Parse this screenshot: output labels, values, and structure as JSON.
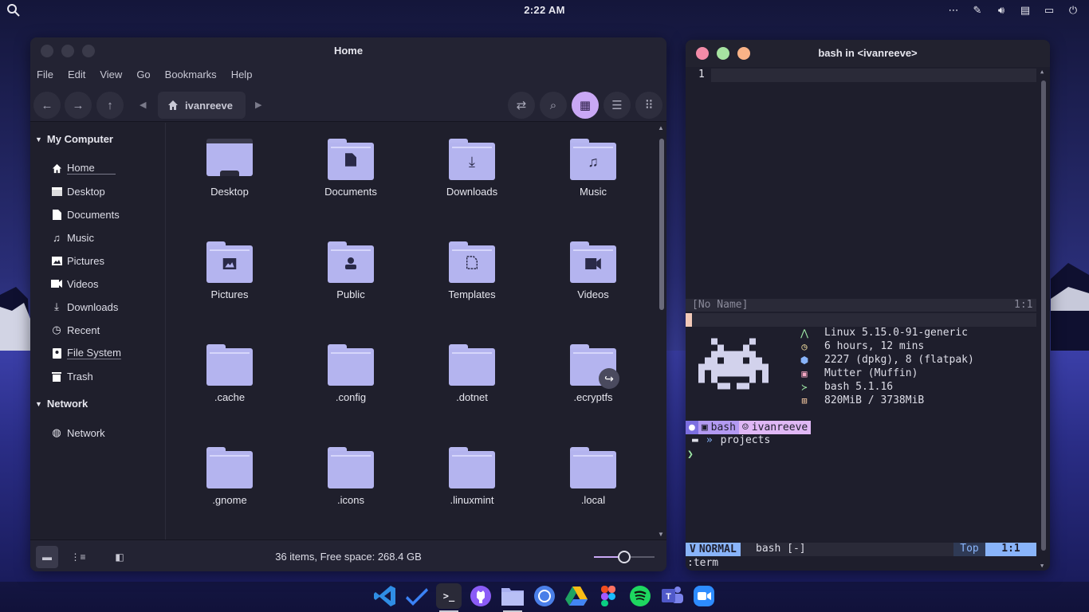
{
  "panel": {
    "clock": "2:22 AM",
    "tray_icons": [
      "more-icon",
      "color-picker-icon",
      "volume-icon",
      "clipboard-icon",
      "screen-icon",
      "power-icon"
    ]
  },
  "file_manager": {
    "title": "Home",
    "menu": [
      "File",
      "Edit",
      "View",
      "Go",
      "Bookmarks",
      "Help"
    ],
    "breadcrumb": "ivanreeve",
    "sidebar": {
      "section_computer": "My Computer",
      "computer_items": [
        {
          "label": "Home",
          "icon": "home-icon"
        },
        {
          "label": "Desktop",
          "icon": "desktop-icon"
        },
        {
          "label": "Documents",
          "icon": "document-icon"
        },
        {
          "label": "Music",
          "icon": "music-icon"
        },
        {
          "label": "Pictures",
          "icon": "picture-icon"
        },
        {
          "label": "Videos",
          "icon": "video-icon"
        },
        {
          "label": "Downloads",
          "icon": "download-icon"
        },
        {
          "label": "Recent",
          "icon": "recent-icon"
        },
        {
          "label": "File System",
          "icon": "drive-icon"
        },
        {
          "label": "Trash",
          "icon": "trash-icon"
        }
      ],
      "section_network": "Network",
      "network_items": [
        {
          "label": "Network",
          "icon": "globe-icon"
        }
      ]
    },
    "items": [
      {
        "label": "Desktop",
        "emblem": "desktop"
      },
      {
        "label": "Documents",
        "emblem": "document"
      },
      {
        "label": "Downloads",
        "emblem": "download"
      },
      {
        "label": "Music",
        "emblem": "music"
      },
      {
        "label": "Pictures",
        "emblem": "picture"
      },
      {
        "label": "Public",
        "emblem": "public"
      },
      {
        "label": "Templates",
        "emblem": "template"
      },
      {
        "label": "Videos",
        "emblem": "video"
      },
      {
        "label": ".cache",
        "emblem": ""
      },
      {
        "label": ".config",
        "emblem": ""
      },
      {
        "label": ".dotnet",
        "emblem": ""
      },
      {
        "label": ".ecryptfs",
        "emblem": "link"
      },
      {
        "label": ".gnome",
        "emblem": ""
      },
      {
        "label": ".icons",
        "emblem": ""
      },
      {
        "label": ".linuxmint",
        "emblem": ""
      },
      {
        "label": ".local",
        "emblem": ""
      }
    ],
    "status": "36 items, Free space: 268.4 GB",
    "zoom_level": 0.5,
    "accent": "#c9a8f5"
  },
  "terminal": {
    "title": "bash in <ivanreeve>",
    "line_number": "1",
    "buffer_name": "[No Name]",
    "buffer_pos": "1:1",
    "fetch": [
      {
        "icon": "arch-icon",
        "text": "Linux 5.15.0-91-generic",
        "color": "#9ee8a6"
      },
      {
        "icon": "clock-icon",
        "text": "6 hours, 12 mins",
        "color": "#f5e0a0"
      },
      {
        "icon": "package-icon",
        "text": "2227 (dpkg), 8 (flatpak)",
        "color": "#89b4fa"
      },
      {
        "icon": "window-icon",
        "text": "Mutter (Muffin)",
        "color": "#f2a7c3"
      },
      {
        "icon": "shell-icon",
        "text": "bash 5.1.16",
        "color": "#9ee8a6"
      },
      {
        "icon": "memory-icon",
        "text": "820MiB / 3738MiB",
        "color": "#f5c8a0"
      }
    ],
    "prompt": {
      "shell": "bash",
      "user": "ivanreeve"
    },
    "dir_sep": "»",
    "dir": "projects",
    "caret": "❯",
    "mode": "NORMAL",
    "status_file": "bash [-]",
    "status_top": "Top",
    "status_pos": "1:1",
    "cmdline": ":term"
  },
  "dock": [
    "vscode-icon",
    "todo-icon",
    "terminal-icon",
    "github-icon",
    "files-icon",
    "chromium-icon",
    "drive-icon",
    "figma-icon",
    "spotify-icon",
    "teams-icon",
    "zoom-icon"
  ]
}
